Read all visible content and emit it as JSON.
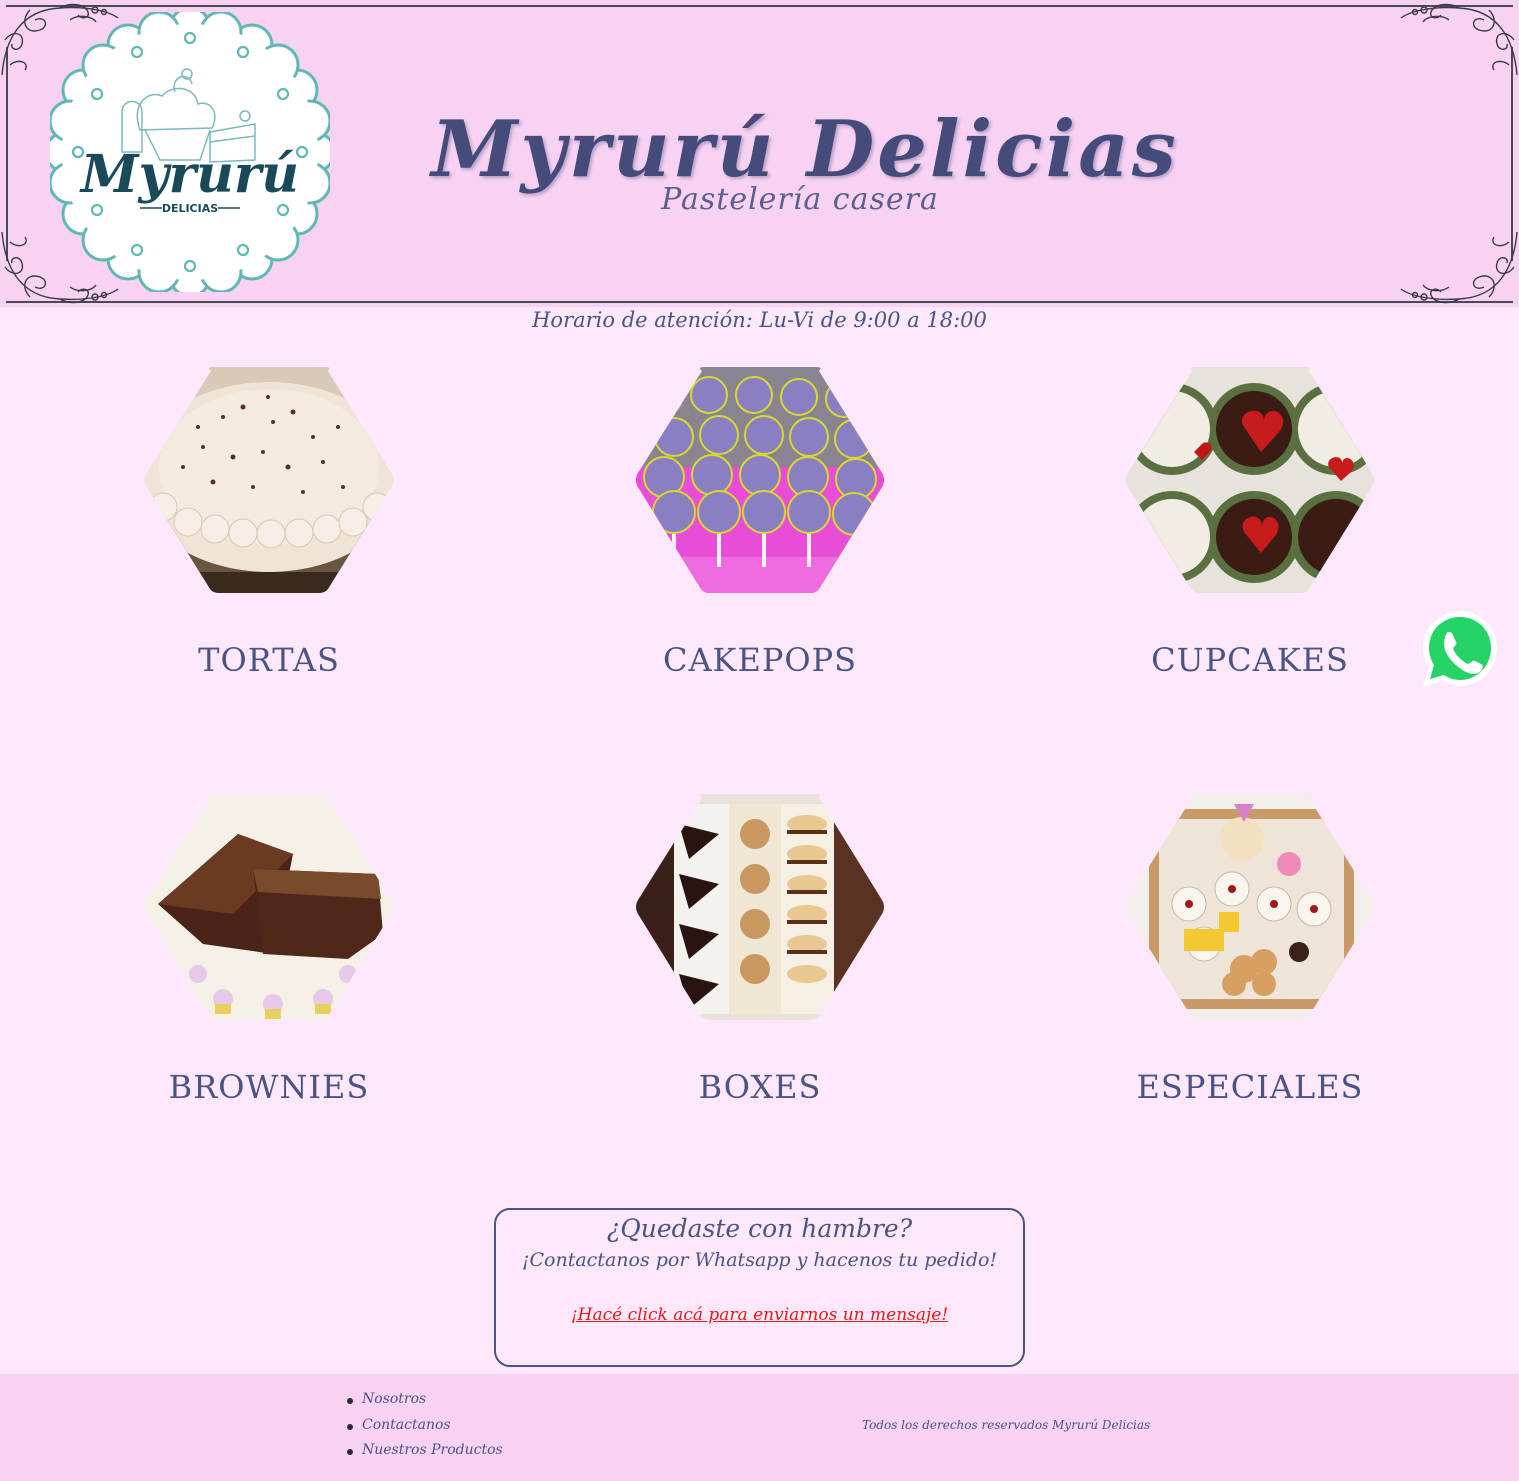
{
  "header": {
    "title": "Myrurú Delicias",
    "subtitle": "Pastelería casera",
    "logo_main": "Myrurú",
    "logo_sub": "DELICIAS"
  },
  "hours": "Horario de atención: Lu-Vi de 9:00 a 18:00",
  "products": [
    {
      "label": "TORTAS",
      "icon": "cake-photo"
    },
    {
      "label": "CAKEPOPS",
      "icon": "cakepops-photo"
    },
    {
      "label": "CUPCAKES",
      "icon": "cupcakes-photo"
    },
    {
      "label": "BROWNIES",
      "icon": "brownies-photo"
    },
    {
      "label": "BOXES",
      "icon": "boxes-photo"
    },
    {
      "label": "ESPECIALES",
      "icon": "especiales-photo"
    }
  ],
  "cta": {
    "title": "¿Quedaste con hambre?",
    "text": "¡Contactanos por Whatsapp y hacenos tu pedido!",
    "link": "¡Hacé click acá para enviarnos un mensaje!"
  },
  "footer": {
    "nav": [
      "Nosotros",
      "Contactanos",
      "Nuestros Productos"
    ],
    "copyright": "Todos los derechos reservados Myrurú Delicias"
  },
  "colors": {
    "background": "#fde8fb",
    "header_bg": "#f7d2f2",
    "text": "#4a5382",
    "link_red": "#e8191b",
    "whatsapp_green": "#25d366",
    "logo_teal": "#5fb8b4",
    "logo_navy": "#1a4a5a"
  }
}
